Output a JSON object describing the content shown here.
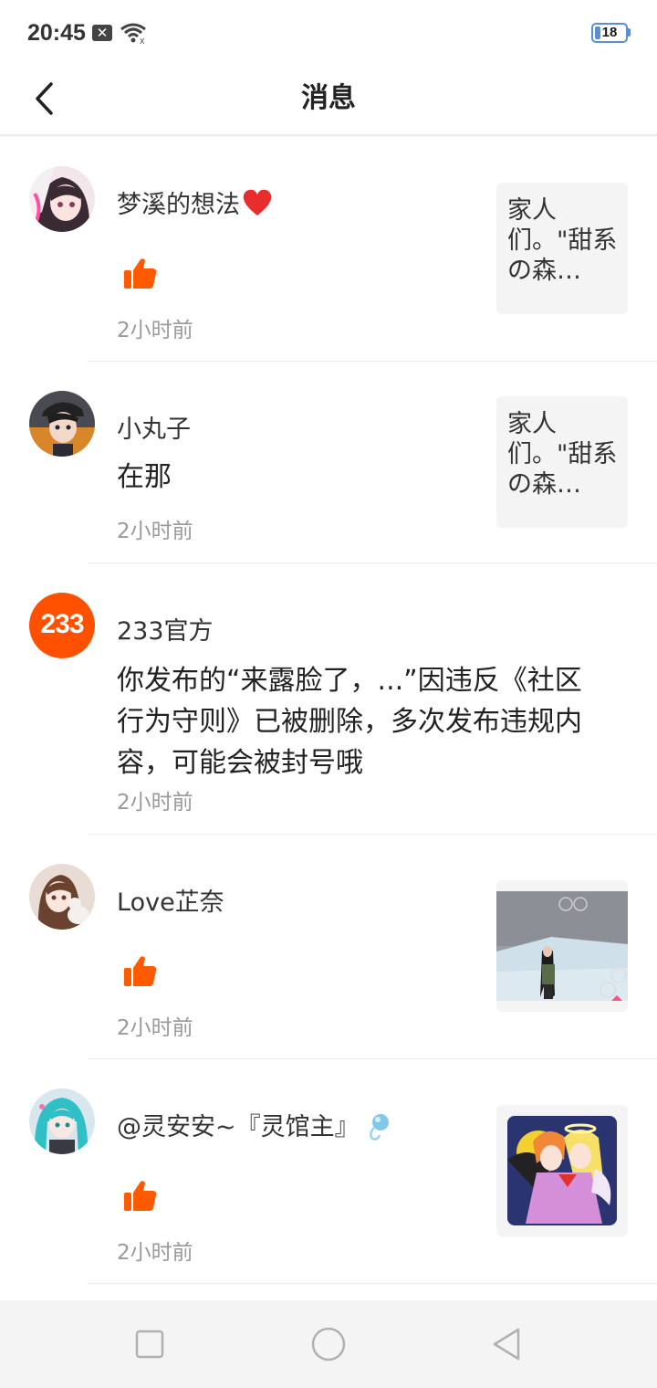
{
  "status_bar": {
    "time": "20:45",
    "notification_badge": "✕",
    "battery_level": "18",
    "battery_fraction": 0.18
  },
  "header": {
    "title": "消息"
  },
  "messages": [
    {
      "name": "梦溪的想法",
      "has_heart": true,
      "type": "like",
      "time": "2小时前",
      "thumbnail_text": "家人们。\"甜系の森…"
    },
    {
      "name": "小丸子",
      "type": "comment",
      "comment": "在那",
      "time": "2小时前",
      "thumbnail_text": "家人们。\"甜系の森…"
    },
    {
      "name": "233官方",
      "type": "system",
      "avatar_text": "233",
      "comment": "你发布的“来露脸了，...”因违反《社区行为守则》已被删除，多次发布违规内容，可能会被封号哦",
      "time": "2小时前"
    },
    {
      "name": "Love芷奈",
      "type": "like",
      "time": "2小时前",
      "thumbnail": "game-screenshot"
    },
    {
      "name": "@灵安安~『灵馆主』",
      "type": "like",
      "time": "2小时前",
      "thumbnail": "anime-illustration"
    }
  ],
  "colors": {
    "accent": "#ff5a00",
    "official_avatar": "#ff5000",
    "heart": "#e82d2d"
  },
  "nav_bar": {
    "icons": [
      "square-icon",
      "circle-icon",
      "triangle-back-icon"
    ]
  }
}
